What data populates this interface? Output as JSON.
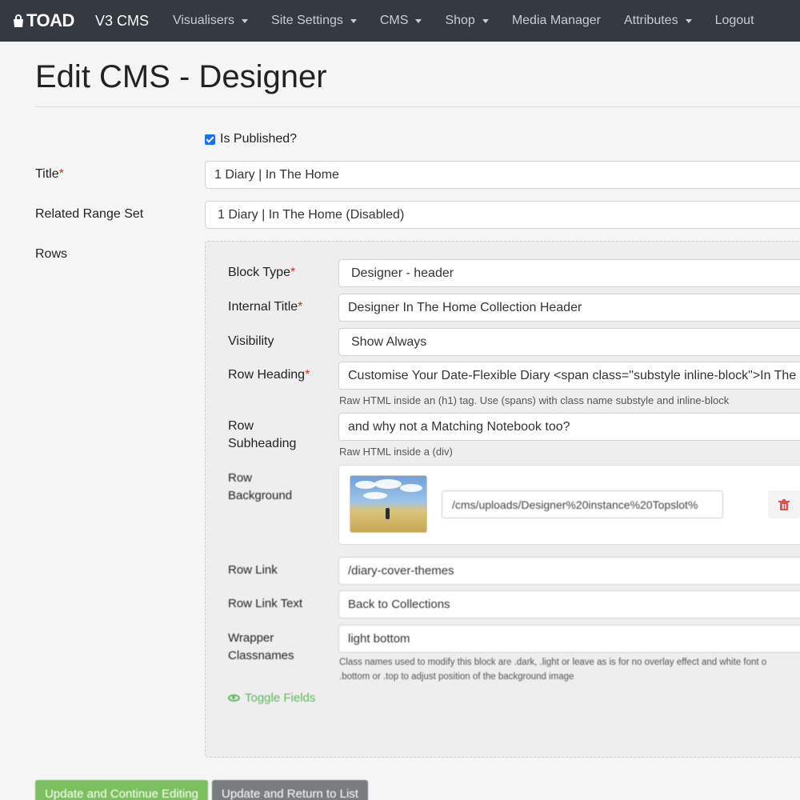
{
  "navbar": {
    "logo_text": "TOAD",
    "brand_name": "V3 CMS",
    "items": [
      {
        "label": "Visualisers",
        "dropdown": true
      },
      {
        "label": "Site Settings",
        "dropdown": true
      },
      {
        "label": "CMS",
        "dropdown": true
      },
      {
        "label": "Shop",
        "dropdown": true
      },
      {
        "label": "Media Manager",
        "dropdown": false
      },
      {
        "label": "Attributes",
        "dropdown": true
      },
      {
        "label": "Logout",
        "dropdown": false
      }
    ]
  },
  "page": {
    "title": "Edit CMS - Designer"
  },
  "form": {
    "is_published_label": "Is Published?",
    "is_published": true,
    "title_label": "Title",
    "title_value": "1 Diary | In The Home",
    "range_set_label": "Related Range Set",
    "range_set_value": "1 Diary | In The Home (Disabled)",
    "rows_label": "Rows",
    "required_mark": "*"
  },
  "row": {
    "block_type_label": "Block Type",
    "block_type_value": "Designer - header",
    "internal_title_label": "Internal Title",
    "internal_title_value": "Designer In The Home Collection Header",
    "visibility_label": "Visibility",
    "visibility_value": "Show Always",
    "heading_label": "Row Heading",
    "heading_value": "Customise Your Date-Flexible Diary <span class=\"substyle inline-block\">In The Home",
    "heading_help": "Raw HTML inside an (h1) tag. Use (spans) with class name substyle and inline-block",
    "subheading_label_1": "Row",
    "subheading_label_2": "Subheading",
    "subheading_value": "and why not a Matching Notebook too?",
    "subheading_help": "Raw HTML inside a (div)",
    "background_label_1": "Row",
    "background_label_2": "Background",
    "background_path": "/cms/uploads/Designer%20instance%20Topslot%",
    "link_label": "Row Link",
    "link_value": "/diary-cover-themes",
    "link_text_label": "Row Link Text",
    "link_text_value": "Back to Collections",
    "wrapper_label_1": "Wrapper",
    "wrapper_label_2": "Classnames",
    "wrapper_value": "light bottom",
    "wrapper_help_1": "Class names used to modify this block are .dark, .light or leave as is for no overlay effect and white font o",
    "wrapper_help_2": ".bottom or .top to adjust position of the background image",
    "toggle_fields": "Toggle Fields"
  },
  "buttons": {
    "update_continue": "Update and Continue Editing",
    "update_return": "Update and Return to List"
  },
  "colors": {
    "navbar_bg": "#343a40",
    "required": "#c0392b",
    "primary_green": "#7cbf5e",
    "secondary_grey": "#7a7d80",
    "checkbox": "#1a73e8",
    "delete_icon": "#d9534f"
  }
}
